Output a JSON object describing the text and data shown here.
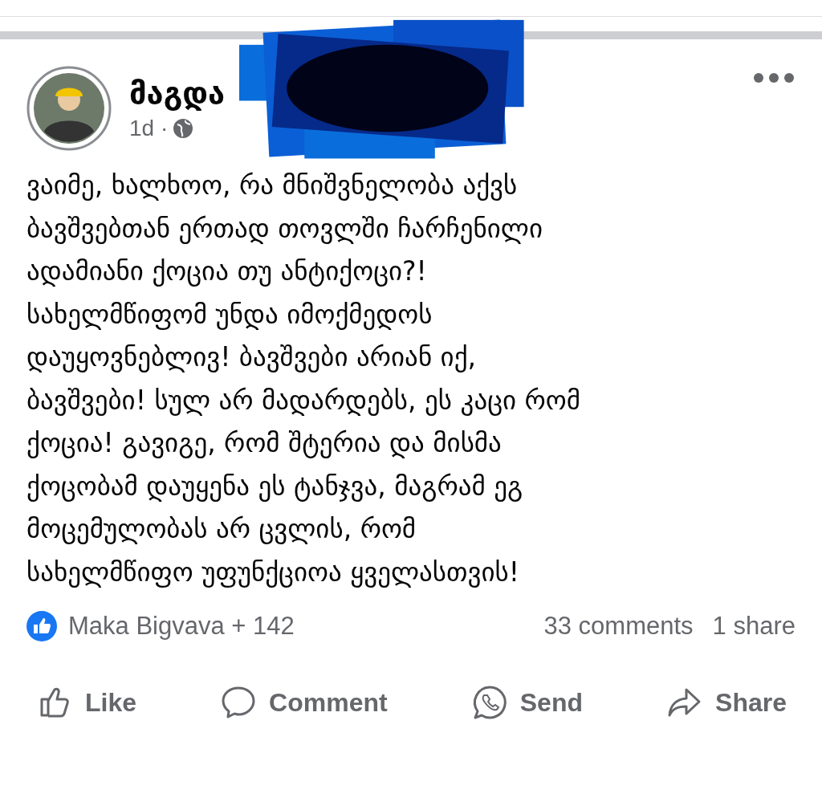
{
  "post": {
    "author": "მაგდა",
    "time": "1d ·",
    "text_lines": [
      "ვაიმე, ხალხოო, რა მნიშვნელობა აქვს",
      "ბავშვებთან ერთად თოვლში ჩარჩენილი",
      "ადამიანი ქოცია თუ ანტიქოცი?!",
      "სახელმწიფომ უნდა იმოქმედოს",
      "დაუყოვნებლივ! ბავშვები არიან იქ,",
      "ბავშვები! სულ არ მადარდებს, ეს კაცი რომ",
      "ქოცია! გავიგე, რომ შტერია და მისმა",
      "ქოცობამ დაუყენა ეს ტანჯვა, მაგრამ ეგ",
      "მოცემულობას არ ცვლის, რომ",
      "სახელმწიფო უფუნქციოა ყველასთვის!"
    ],
    "reactions": "Maka Bigvava + 142",
    "comments": "33 comments",
    "shares": "1 share"
  },
  "actions": [
    {
      "kind": "like",
      "label": "Like"
    },
    {
      "kind": "comment",
      "label": "Comment"
    },
    {
      "kind": "send",
      "label": "Send"
    },
    {
      "kind": "share",
      "label": "Share"
    }
  ]
}
